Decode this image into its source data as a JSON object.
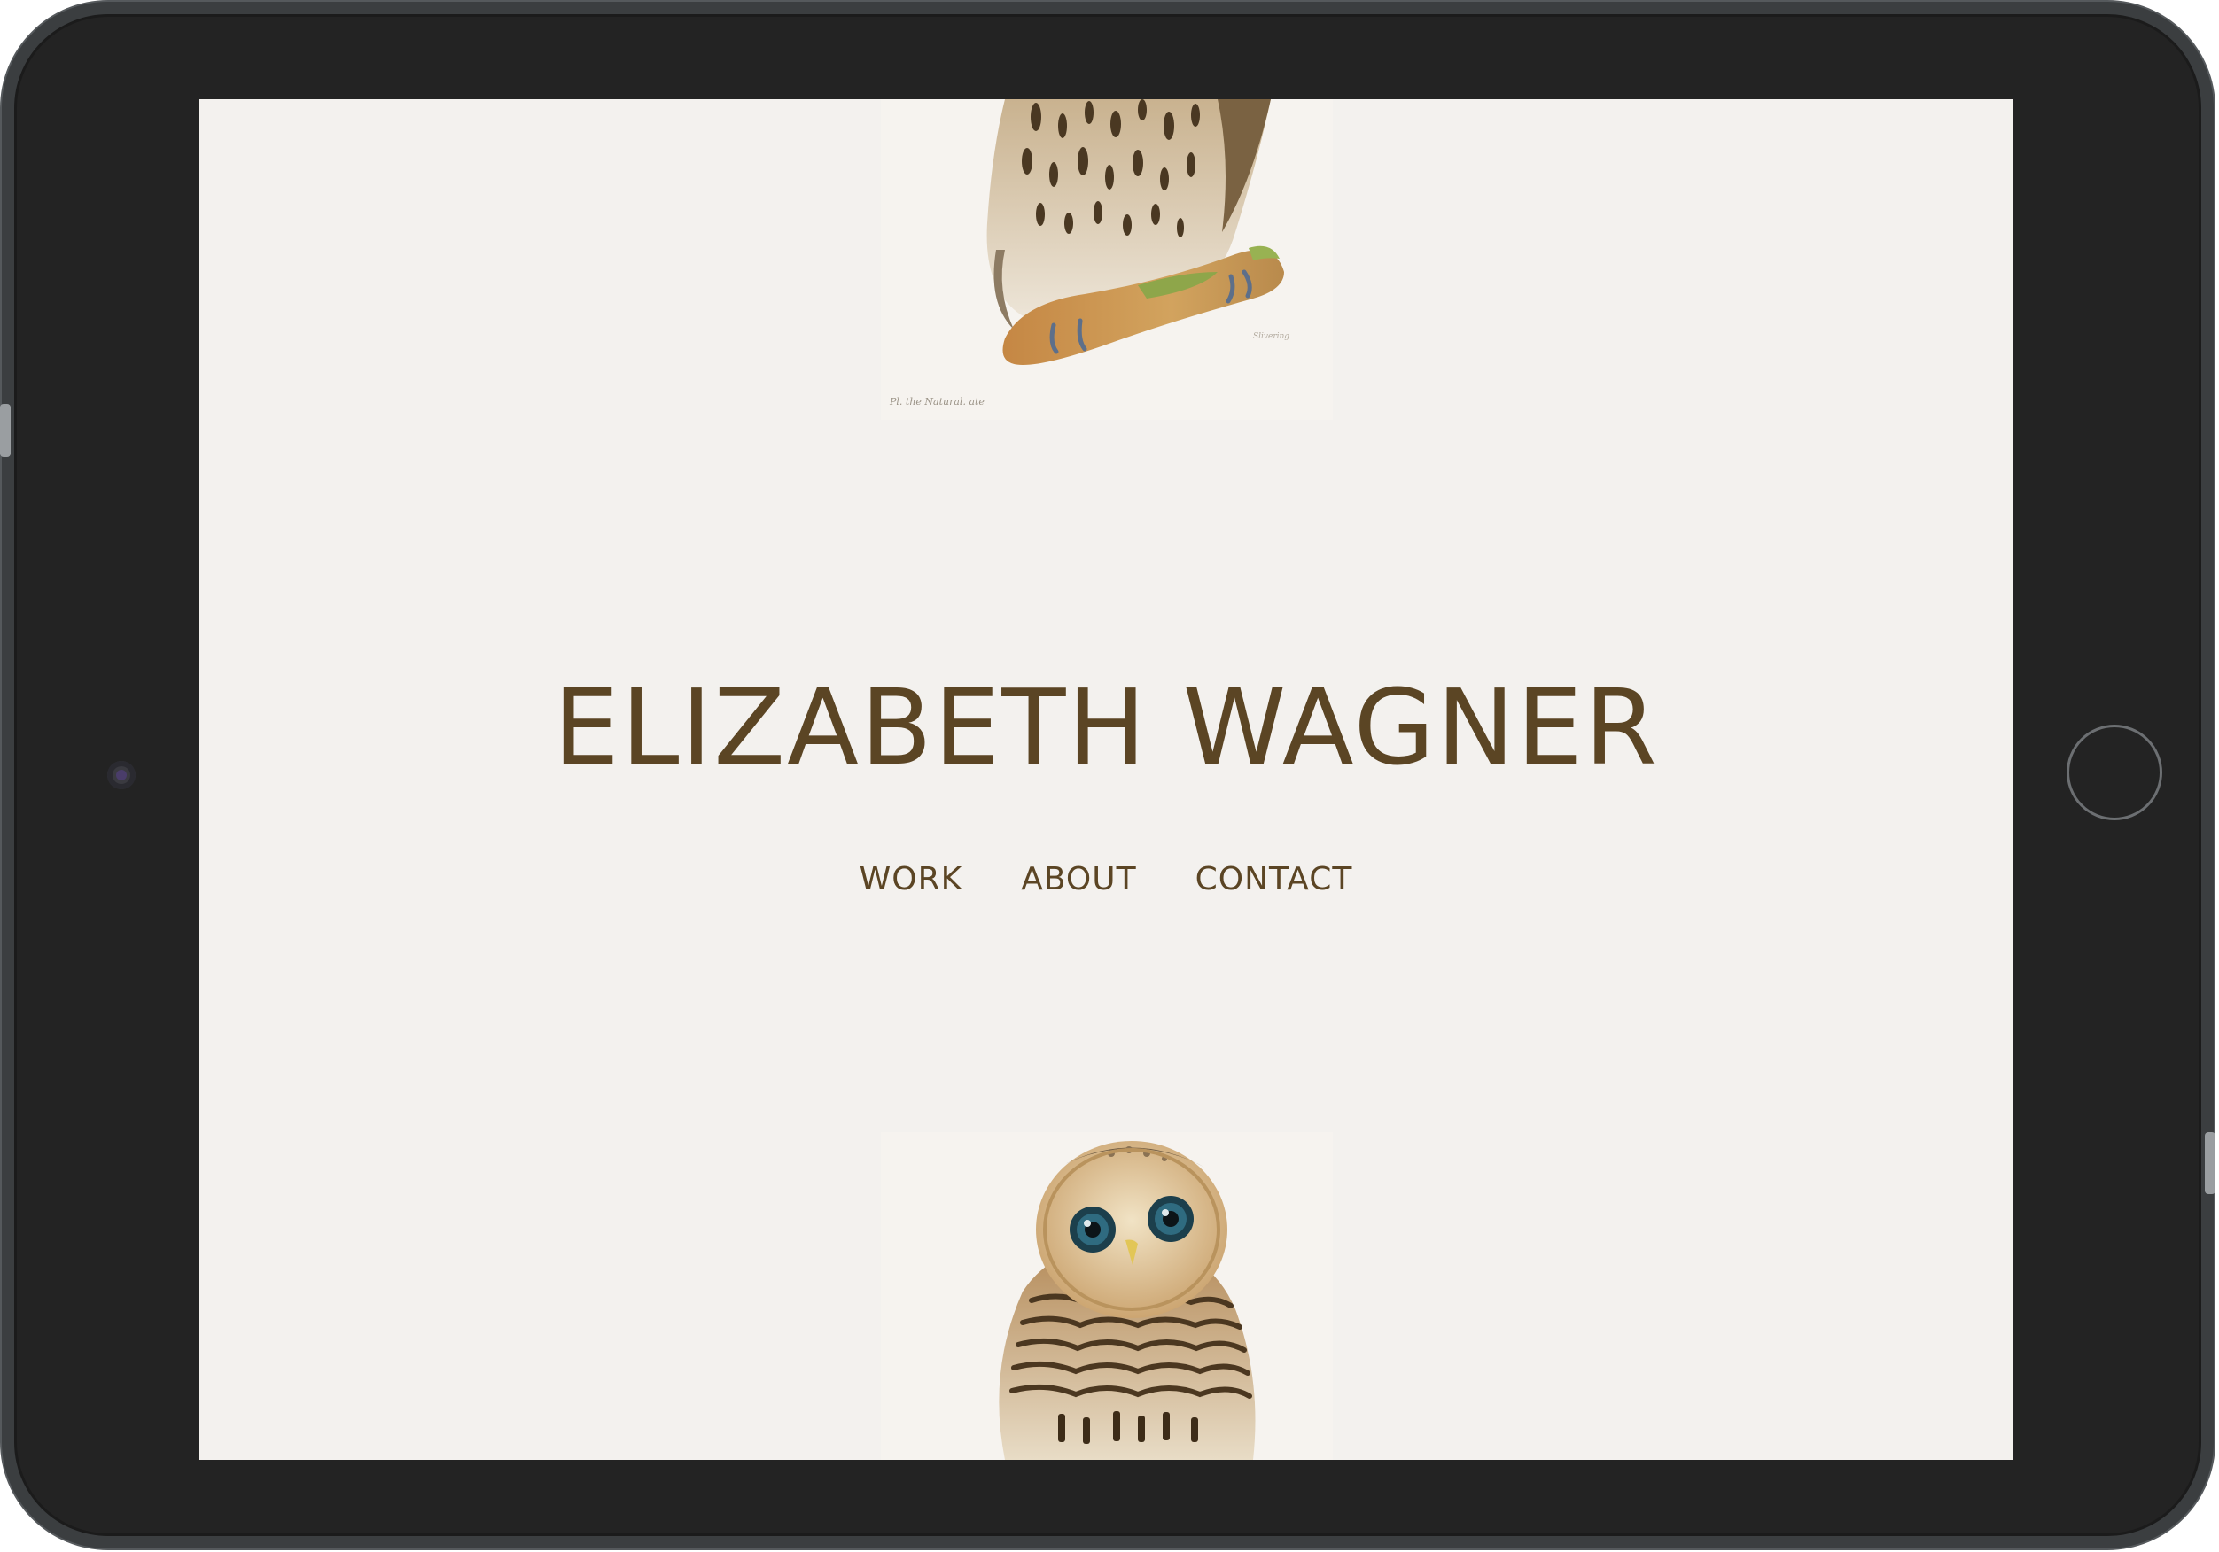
{
  "site": {
    "title": "ELIZABETH WAGNER"
  },
  "nav": {
    "items": [
      {
        "label": "WORK"
      },
      {
        "label": "ABOUT"
      },
      {
        "label": "CONTACT"
      }
    ]
  },
  "illustrations": {
    "top": {
      "caption": "Pl. the Natural. ate",
      "signature": "Slivering"
    }
  },
  "colors": {
    "text": "#5b4524",
    "background": "#f3f1ee",
    "bezel": "#232323"
  }
}
